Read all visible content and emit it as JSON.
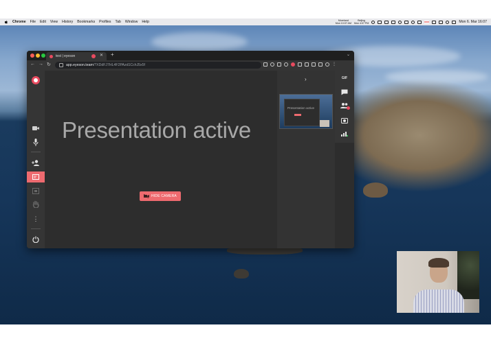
{
  "menubar": {
    "app": "Chrome",
    "items": [
      "File",
      "Edit",
      "View",
      "History",
      "Bookmarks",
      "Profiles",
      "Tab",
      "Window",
      "Help"
    ],
    "weather_a_label": "Moreland",
    "weather_a_time": "Mon 10:07 AM",
    "weather_b_label": "Beijing",
    "weather_b_time": "Mon 4:07 PM",
    "clock": "Mon 6. Mar 16:07"
  },
  "browser": {
    "tab_title": "test | eyeson",
    "tab_close": "✕",
    "new_tab": "+",
    "tab_menu": "⌄",
    "url_host": "app.eyeson.team",
    "url_path": "/?XDdFJ7HL4F2PAzd1CchJ5x5f"
  },
  "app": {
    "presentation_text": "Presentation active",
    "hide_camera_label": "HIDE CAMERA",
    "panel_toggle": "›",
    "gif_label": "GIF",
    "thumbnail_text": "Presentation active"
  },
  "colors": {
    "accent": "#ee6a6f",
    "brand": "#e84a5f",
    "stage_bg": "#2d2d2d",
    "sidebar_bg": "#353535"
  },
  "icons": {
    "left_sidebar": [
      "eyeson-logo",
      "camera-icon",
      "microphone-icon",
      "add-user-icon",
      "presentation-icon",
      "screen-share-icon",
      "hand-icon",
      "more-icon",
      "power-icon"
    ],
    "right_toolbar": [
      "gif-icon",
      "chat-icon",
      "participants-icon",
      "snapshot-icon",
      "signal-icon"
    ]
  }
}
